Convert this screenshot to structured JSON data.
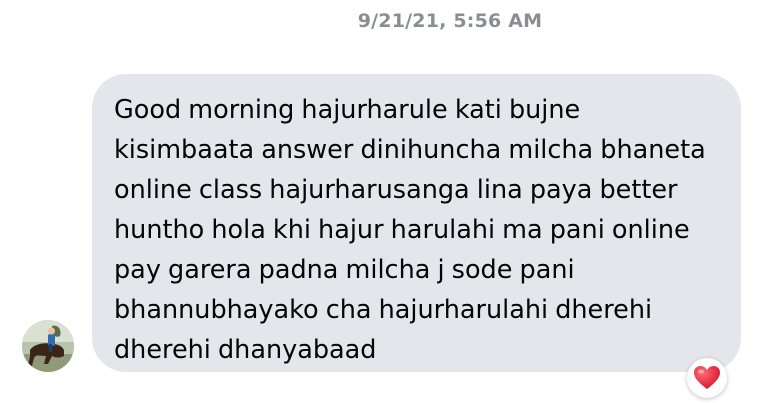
{
  "conversation": {
    "timestamp": "9/21/21, 5:56 AM"
  },
  "message": {
    "text": "Good morning hajurharule kati bujne\nkisimbaata answer dinihuncha milcha bhaneta\nonline class hajurharusanga lina paya better\nhuntho hola khi hajur harulahi ma pani online\npay garera padna milcha j sode pani\nbhannubhayako cha hajurharulahi dherehi\ndherehi dhanyabaad",
    "bubble_color": "#e4e6eb",
    "text_color": "#050505"
  },
  "sender": {
    "avatar_icon": "profile-photo-person-on-horse"
  },
  "reaction": {
    "emoji_icon": "heart-icon",
    "color": "#e8283c"
  }
}
